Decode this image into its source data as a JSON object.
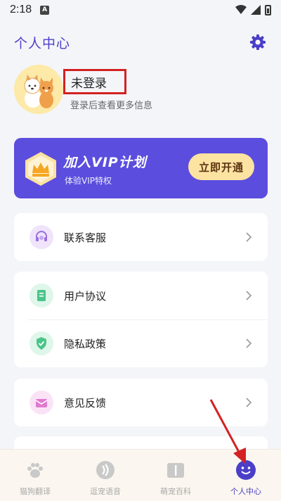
{
  "status_bar": {
    "time": "2:18",
    "notification": "A"
  },
  "header": {
    "title": "个人中心"
  },
  "profile": {
    "name": "未登录",
    "hint": "登录后查看更多信息"
  },
  "vip": {
    "title": "加入VIP计划",
    "subtitle": "体验VIP特权",
    "button": "立即开通"
  },
  "menu": {
    "contact": {
      "label": "联系客服",
      "icon": "headset-icon"
    },
    "agreement": {
      "label": "用户协议",
      "icon": "document-icon"
    },
    "privacy": {
      "label": "隐私政策",
      "icon": "shield-icon"
    },
    "feedback": {
      "label": "意见反馈",
      "icon": "envelope-icon"
    }
  },
  "tabs": [
    {
      "label": "猫狗翻译",
      "icon": "paw-icon"
    },
    {
      "label": "逗宠语音",
      "icon": "voice-icon"
    },
    {
      "label": "萌宠百科",
      "icon": "book-icon"
    },
    {
      "label": "个人中心",
      "icon": "smile-icon"
    }
  ],
  "colors": {
    "accent": "#4b3fc8",
    "vip_bg": "#5b4dde",
    "vip_button": "#fde3a1",
    "highlight_box": "#d32222"
  }
}
